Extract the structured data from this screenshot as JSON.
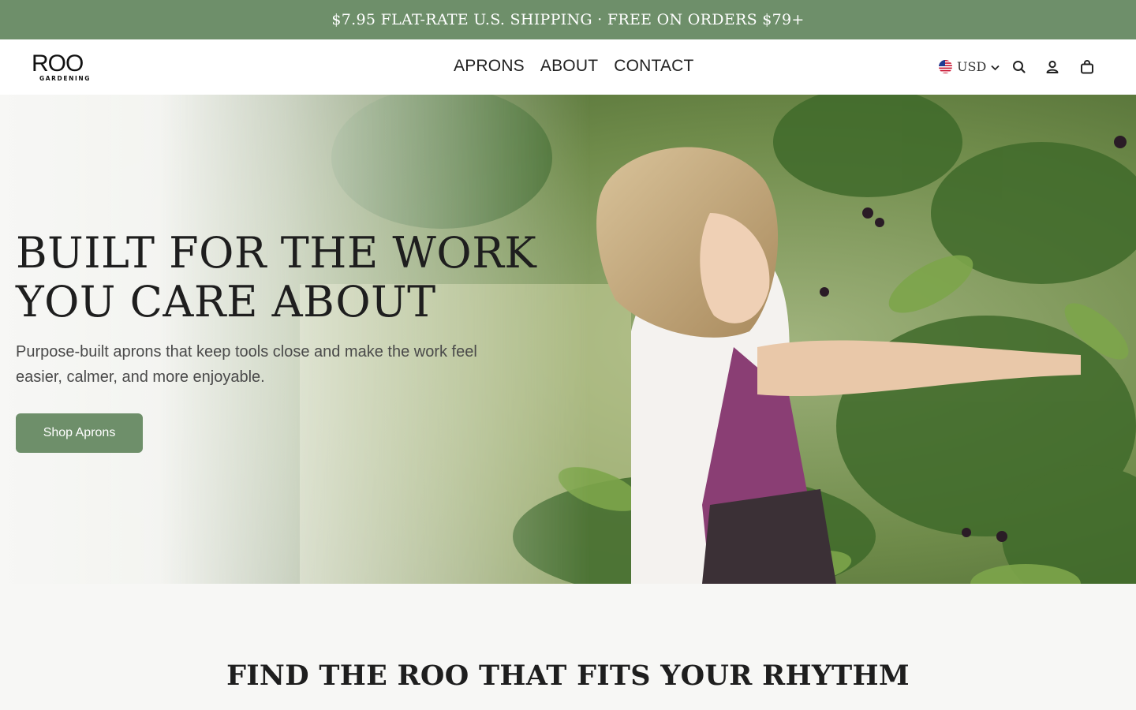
{
  "announcement": {
    "text": "$7.95 FLAT-RATE U.S. SHIPPING · FREE ON ORDERS $79+"
  },
  "header": {
    "logo": {
      "mark": "ROO",
      "sub": "GARDENING"
    },
    "nav": [
      "APRONS",
      "ABOUT",
      "CONTACT"
    ],
    "currency": {
      "label": "USD",
      "flag": "us-flag-icon"
    },
    "icons": [
      "search-icon",
      "account-icon",
      "cart-icon"
    ]
  },
  "hero": {
    "title_line1": "BUILT FOR THE WORK",
    "title_line2": "YOU CARE ABOUT",
    "subtitle": "Purpose-built aprons that keep tools close and make the work feel easier, calmer, and more enjoyable.",
    "cta": "Shop Aprons"
  },
  "section": {
    "title": "FIND THE ROO THAT FITS YOUR RHYTHM"
  },
  "colors": {
    "brand_green": "#6e8f6a",
    "background": "#f7f7f5",
    "text": "#1e1e1e"
  }
}
